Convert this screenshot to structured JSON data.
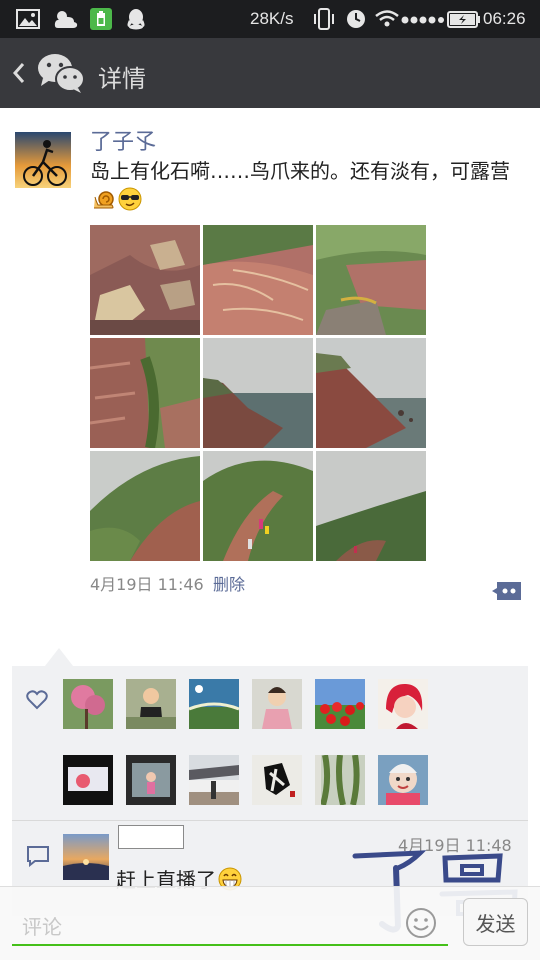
{
  "status_bar": {
    "network_speed": "28K/s",
    "time": "06:26",
    "icons": [
      "image-icon",
      "weather-icon",
      "battery-saver-icon",
      "qq-icon",
      "vibrate-icon",
      "alarm-icon",
      "wifi-icon",
      "signal-icon",
      "battery-icon"
    ]
  },
  "title_bar": {
    "title": "详情"
  },
  "post": {
    "author": "了子孓",
    "text": "岛上有化石嗬……鸟爪来的。还有淡有，可露营",
    "time": "4月19日 11:46",
    "delete_label": "删除",
    "photo_count": 9
  },
  "likes": {
    "count": 12
  },
  "comment": {
    "time": "4月19日 11:48",
    "text": "赶上直播了"
  },
  "watermark": {
    "text": "了哥"
  },
  "input": {
    "placeholder": "评论",
    "value": "",
    "send_label": "发送"
  },
  "colors": {
    "status_bar": "#1c1d1f",
    "title_bar": "#38393d",
    "link": "#5b6b97",
    "accent_green": "#45c01a",
    "likes_bg": "#f0f1f3"
  }
}
